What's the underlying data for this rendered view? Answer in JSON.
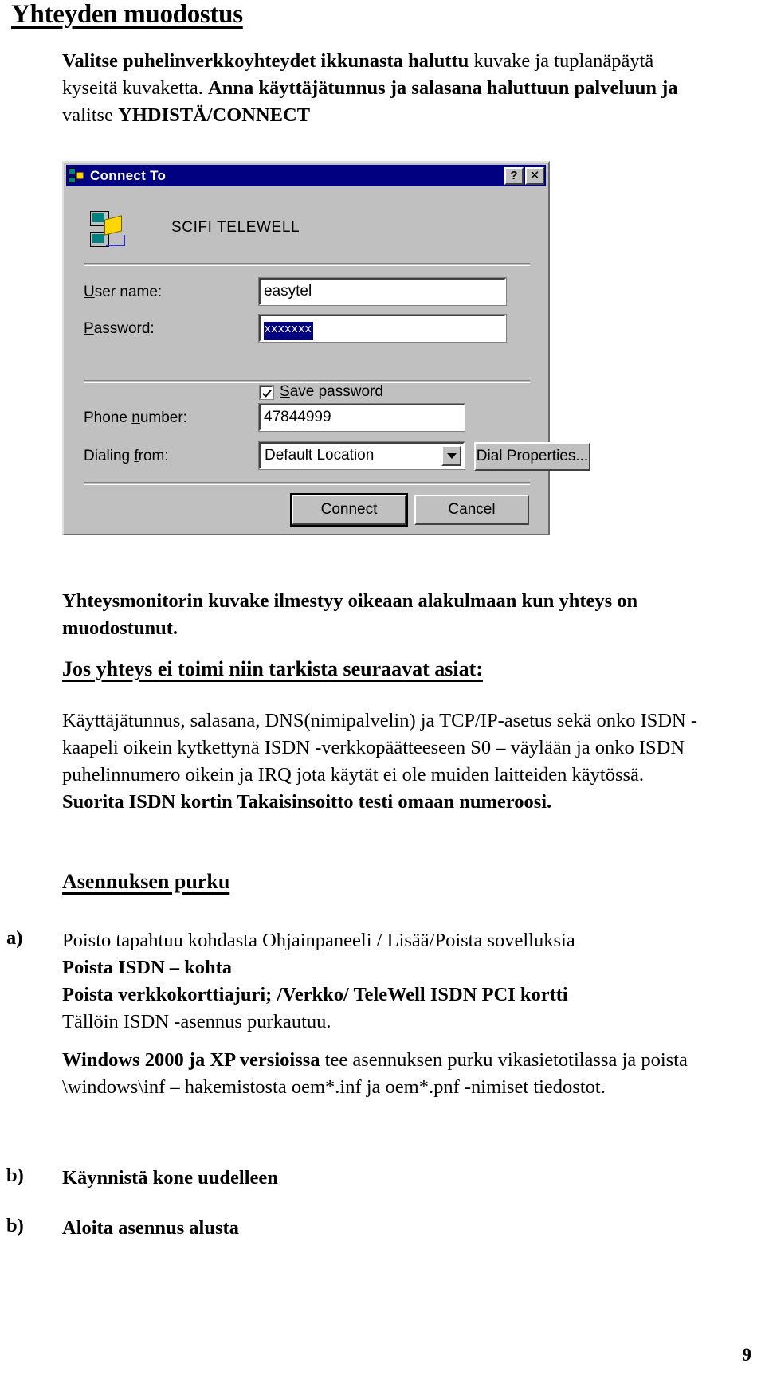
{
  "page": {
    "title": "Yhteyden muodostus",
    "number": "9"
  },
  "intro": {
    "bold_part": "Valitse puhelinverkkoyhteydet ikkunasta haluttu",
    "rest_line1": " kuvake ja tuplanäpäytä",
    "line2_normal": "kyseitä kuvaketta. ",
    "line2_bold": "Anna käyttäjätunnus ja salasana haluttuun palveluun ja",
    "line3_normal": "valitse ",
    "line3_bold": "YHDISTÄ/CONNECT"
  },
  "dialog": {
    "title": "Connect To",
    "title_icon": "network-connection-icon",
    "help_button": "?",
    "close_button": "✕",
    "connection_name": "SCIFI TELEWELL",
    "fields": {
      "user_name_label": "User name:",
      "user_name_value": "easytel",
      "password_label": "Password:",
      "password_value": "xxxxxxx",
      "save_password_label": "Save password",
      "save_password_checked": true,
      "phone_number_label": "Phone number:",
      "phone_number_value": "47844999",
      "dialing_from_label": "Dialing from:",
      "dialing_from_value": "Default Location"
    },
    "buttons": {
      "dial_properties": "Dial Properties...",
      "connect": "Connect",
      "cancel": "Cancel"
    },
    "colors": {
      "titlebar": "#000080",
      "face": "#c0c0c0",
      "selection": "#000080"
    }
  },
  "body": {
    "monitor_note": "Yhteysmonitorin kuvake ilmestyy oikeaan alakulmaan kun yhteys on muodostunut.",
    "troubleshoot_heading": "Jos yhteys ei toimi niin tarkista seuraavat asiat:",
    "troubleshoot_text": "Käyttäjätunnus, salasana, DNS(nimipalvelin) ja TCP/IP-asetus sekä onko ISDN -kaapeli oikein kytkettynä ISDN -verkkopäätteeseen S0 – väylään ja onko ISDN puhelinnumero oikein ja IRQ jota käytät ei ole muiden laitteiden käytössä. ",
    "troubleshoot_bold": "Suorita ISDN kortin Takaisinsoitto testi omaan numeroosi.",
    "uninstall_heading": "Asennuksen purku",
    "items": [
      {
        "marker": "a)",
        "line1": "Poisto tapahtuu kohdasta Ohjainpaneeli / Lisää/Poista sovelluksia",
        "line2_bold": "Poista ISDN – kohta",
        "line3_bold": "Poista verkkokorttiajuri; /Verkko/ TeleWell ISDN PCI kortti",
        "line4": "Tällöin ISDN -asennus purkautuu.",
        "note_bold": "Windows 2000 ja XP versioissa",
        "note_rest": " tee asennuksen purku vikasietotilassa ja",
        "note_line2": "poista \\windows\\inf – hakemistosta oem*.inf ja oem*.pnf -nimiset tiedostot."
      },
      {
        "marker": "b)",
        "line1_bold": "Käynnistä kone uudelleen"
      },
      {
        "marker": "b)",
        "line1_bold": "Aloita asennus alusta"
      }
    ]
  }
}
